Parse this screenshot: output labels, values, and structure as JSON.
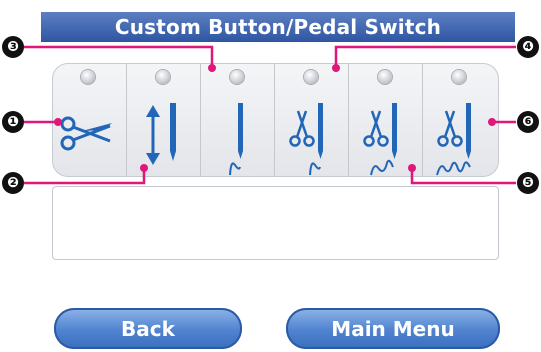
{
  "title": "Custom Button/Pedal Switch",
  "icons": [
    {
      "name": "thread-cutter-icon"
    },
    {
      "name": "needle-up-down-icon"
    },
    {
      "name": "single-stitch-icon"
    },
    {
      "name": "cut-single-stitch-icon"
    },
    {
      "name": "cut-double-stitch-icon"
    },
    {
      "name": "cut-triple-stitch-icon"
    }
  ],
  "buttons": {
    "back": "Back",
    "main_menu": "Main Menu"
  },
  "callouts": [
    "❶",
    "❷",
    "❸",
    "❹",
    "❺",
    "❻"
  ],
  "colors": {
    "title_bar": "#2f56a3",
    "icon": "#2266b8",
    "callout_line": "#e0177a"
  }
}
